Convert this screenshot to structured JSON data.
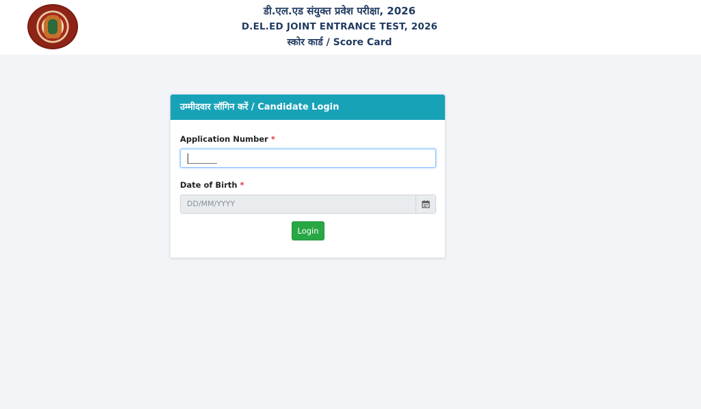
{
  "header": {
    "title_hindi": "डी.एल.एड संयुक्त प्रवेश परीक्षा, 2026",
    "title_english": "D.EL.ED JOINT ENTRANCE TEST, 2026",
    "subtitle": "स्कोर कार्ड / Score Card"
  },
  "login_card": {
    "heading": "उम्मीदवार लॉगिन करें / Candidate Login",
    "application_number_label": "Application Number",
    "application_number_value": "",
    "dob_label": "Date of Birth",
    "dob_placeholder": "DD/MM/YYYY",
    "required_mark": "*",
    "login_button": "Login"
  },
  "colors": {
    "card_header": "#17a2b8",
    "login_button": "#28a745",
    "required": "#dc3545",
    "title_text": "#1f3a5f"
  },
  "icons": {
    "logo": "bihar-board-seal-icon",
    "calendar": "calendar-icon"
  }
}
